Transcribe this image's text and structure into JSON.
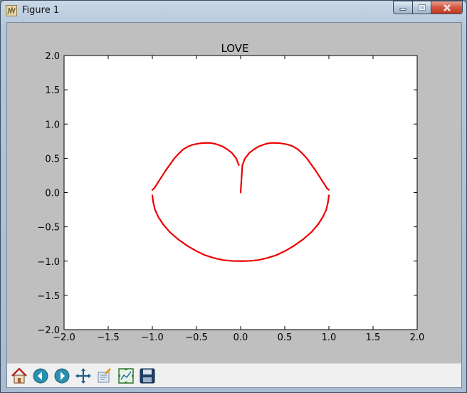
{
  "window": {
    "title": "Figure 1",
    "app_icon": "matplotlib-figure-icon",
    "buttons": [
      "minimize-icon",
      "maximize-icon",
      "close-icon"
    ]
  },
  "toolbar": {
    "tools": [
      "home-icon",
      "back-arrow-icon",
      "forward-arrow-icon",
      "pan-move-icon",
      "zoom-rect-icon",
      "configure-subplots-icon",
      "save-disk-icon"
    ]
  },
  "colors": {
    "curve": "#ee0000",
    "figure_bg": "#bfbfbf",
    "axes_bg": "#ffffff",
    "toolbar_bg": "#f0f0f0"
  },
  "chart_data": {
    "type": "line",
    "title": "LOVE",
    "xlabel": "",
    "ylabel": "",
    "xlim": [
      -2.0,
      2.0
    ],
    "ylim": [
      -2.0,
      2.0
    ],
    "xticks": [
      "−2.0",
      "−1.5",
      "−1.0",
      "−0.5",
      "0.0",
      "0.5",
      "1.0",
      "1.5",
      "2.0"
    ],
    "yticks": [
      "2.0",
      "1.5",
      "1.0",
      "0.5",
      "0.0",
      "−0.5",
      "−1.0",
      "−1.5",
      "−2.0"
    ],
    "grid": false,
    "series": [
      {
        "color": "#ee0000",
        "x": [
          0.0,
          0.02,
          0.05,
          0.1,
          0.15,
          0.2,
          0.25,
          0.3,
          0.35,
          0.4,
          0.45,
          0.5,
          0.55,
          0.6,
          0.65,
          0.7,
          0.75,
          0.8,
          0.85,
          0.9,
          0.95,
          0.98,
          1.0
        ],
        "y": [
          0.0,
          0.4,
          0.5,
          0.58,
          0.63,
          0.67,
          0.695,
          0.715,
          0.725,
          0.725,
          0.72,
          0.71,
          0.695,
          0.67,
          0.63,
          0.57,
          0.5,
          0.41,
          0.32,
          0.22,
          0.12,
          0.06,
          0.04
        ]
      },
      {
        "color": "#ee0000",
        "x": [
          -0.02,
          -0.05,
          -0.1,
          -0.15,
          -0.2,
          -0.25,
          -0.3,
          -0.35,
          -0.4,
          -0.45,
          -0.5,
          -0.55,
          -0.6,
          -0.65,
          -0.7,
          -0.75,
          -0.8,
          -0.85,
          -0.9,
          -0.95,
          -0.98,
          -1.0
        ],
        "y": [
          0.4,
          0.5,
          0.58,
          0.63,
          0.67,
          0.695,
          0.715,
          0.725,
          0.725,
          0.72,
          0.71,
          0.695,
          0.67,
          0.63,
          0.57,
          0.5,
          0.41,
          0.32,
          0.22,
          0.12,
          0.06,
          0.04
        ]
      },
      {
        "color": "#ee0000",
        "x": [
          -1.0,
          -0.99,
          -0.97,
          -0.93,
          -0.88,
          -0.8,
          -0.7,
          -0.6,
          -0.5,
          -0.4,
          -0.3,
          -0.2,
          -0.1,
          0.0,
          0.1,
          0.2,
          0.3,
          0.4,
          0.5,
          0.6,
          0.7,
          0.8,
          0.88,
          0.93,
          0.97,
          0.99,
          1.0
        ],
        "y": [
          -0.04,
          -0.14,
          -0.25,
          -0.36,
          -0.46,
          -0.58,
          -0.69,
          -0.78,
          -0.855,
          -0.915,
          -0.955,
          -0.985,
          -0.997,
          -1.0,
          -0.997,
          -0.985,
          -0.955,
          -0.915,
          -0.855,
          -0.78,
          -0.69,
          -0.58,
          -0.46,
          -0.36,
          -0.25,
          -0.14,
          -0.04
        ]
      }
    ]
  }
}
